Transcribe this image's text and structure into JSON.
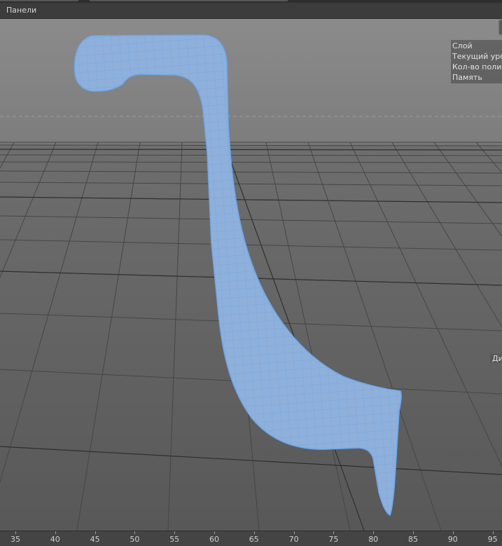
{
  "menubar": {
    "items": [
      "Панели"
    ]
  },
  "hud": {
    "rows": [
      "Слой",
      "Текущий уров",
      "Кол-во полиг",
      "Память"
    ]
  },
  "side_label": "Ди",
  "timeline": {
    "ticks": [
      35,
      40,
      45,
      50,
      55,
      60,
      65,
      70,
      75,
      80,
      85,
      90,
      95
    ]
  },
  "colors": {
    "wire": "#6fa6e6",
    "fill": "#8faed8",
    "grid": "#3b3b3b",
    "bg_top": "#8a8a8a",
    "bg_bottom": "#5c5c5c"
  }
}
